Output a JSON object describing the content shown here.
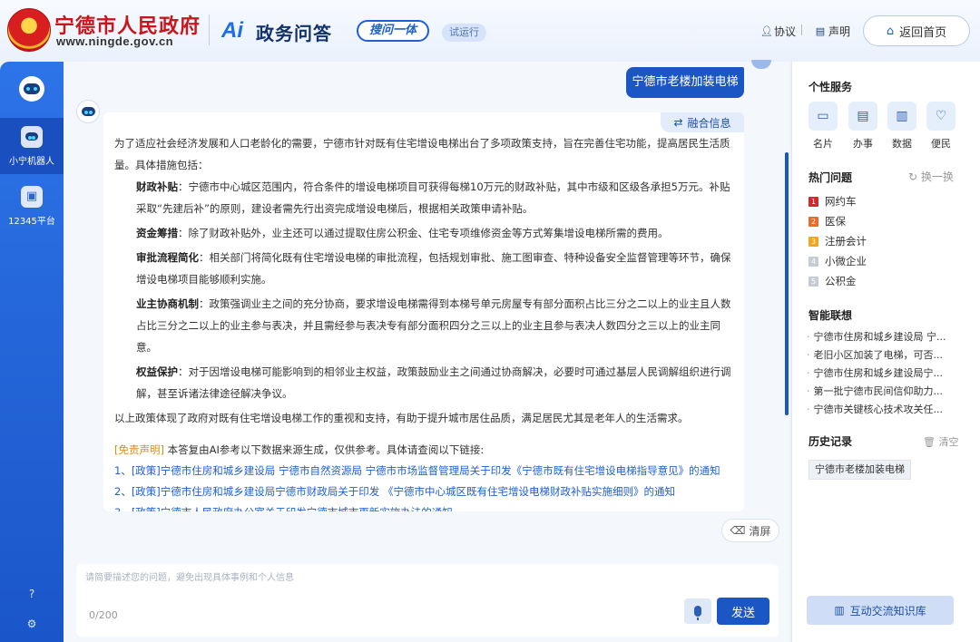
{
  "header": {
    "site_name": "宁德市人民政府",
    "site_url": "www.ningde.gov.cn",
    "product_logo": "Ai",
    "product_name": "政务问答",
    "search_badge": "搜问一体",
    "trial_badge": "试运行",
    "agreement": "协议",
    "statement": "声明",
    "home_button": "返回首页"
  },
  "sidebar": {
    "items": [
      {
        "label": "小宁机器人",
        "icon": "robot-icon"
      },
      {
        "label": "12345平台",
        "icon": "hotline-icon"
      }
    ],
    "bottom_icons": [
      "help-icon",
      "settings-icon"
    ]
  },
  "chat": {
    "user_message": "宁德市老楼加装电梯",
    "fuse_info": "融合信息",
    "intro": "为了适应社会经济发展和人口老龄化的需要，宁德市针对既有住宅增设电梯出台了多项政策支持，旨在完善住宅功能，提高居民生活质量。具体措施包括：",
    "items": [
      {
        "title": "财政补贴",
        "text": "：宁德市中心城区范围内，符合条件的增设电梯项目可获得每梯10万元的财政补贴，其中市级和区级各承担5万元。补贴采取“先建后补”的原则，建设者需先行出资完成增设电梯后，根据相关政策申请补贴。"
      },
      {
        "title": "资金筹措",
        "text": "：除了财政补贴外，业主还可以通过提取住房公积金、住宅专项维修资金等方式筹集增设电梯所需的费用。"
      },
      {
        "title": "审批流程简化",
        "text": "：相关部门将简化既有住宅增设电梯的审批流程，包括规划审批、施工图审查、特种设备安全监督管理等环节，确保增设电梯项目能够顺利实施。"
      },
      {
        "title": "业主协商机制",
        "text": "：政策强调业主之间的充分协商，要求增设电梯需得到本梯号单元房屋专有部分面积占比三分之二以上的业主且人数占比三分之二以上的业主参与表决，并且需经参与表决专有部分面积四分之三以上的业主且参与表决人数四分之三以上的业主同意。"
      },
      {
        "title": "权益保护",
        "text": "：对于因增设电梯可能影响到的相邻业主权益，政策鼓励业主之间通过协商解决，必要时可通过基层人民调解组织进行调解，甚至诉诸法律途径解决争议。"
      }
    ],
    "conclusion": "以上政策体现了政府对既有住宅增设电梯工作的重视和支持，有助于提升城市居住品质，满足居民尤其是老年人的生活需求。",
    "disclaimer_tag": "[免责声明]",
    "disclaimer_text": " 本答复由AI参考以下数据来源生成，仅供参考。具体请查阅以下链接:",
    "references": [
      "1、[政策]宁德市住房和城乡建设局 宁德市自然资源局 宁德市市场监督管理局关于印发《宁德市既有住宅增设电梯指导意见》的通知",
      "2、[政策]宁德市住房和城乡建设局宁德市财政局关于印发 《宁德市中心城区既有住宅增设电梯财政补贴实施细则》的通知",
      "3、[政策]宁德市人民政府办公室关于印发宁德市城市更新实施办法的通知"
    ],
    "clear_screen": "清屏"
  },
  "input": {
    "placeholder": "请简要描述您的问题，避免出现具体事例和个人信息",
    "value": "",
    "counter": "0/200",
    "send": "发送"
  },
  "right_panel": {
    "personal_title": "个性服务",
    "services": [
      {
        "label": "名片",
        "icon": "card-icon"
      },
      {
        "label": "办事",
        "icon": "service-icon"
      },
      {
        "label": "数据",
        "icon": "chart-icon"
      },
      {
        "label": "便民",
        "icon": "heart-icon"
      }
    ],
    "hot_title": "热门问题",
    "refresh": "换一换",
    "hot": [
      {
        "rank": "1",
        "label": "网约车",
        "color": "#d9252b"
      },
      {
        "rank": "2",
        "label": "医保",
        "color": "#ea6a2a"
      },
      {
        "rank": "3",
        "label": "注册会计",
        "color": "#f0a61f"
      },
      {
        "rank": "4",
        "label": "小微企业",
        "color": "#c7ccd4"
      },
      {
        "rank": "5",
        "label": "公积金",
        "color": "#c7ccd4"
      }
    ],
    "assoc_title": "智能联想",
    "assoc": [
      "宁德市住房和城乡建设局 宁...",
      "老旧小区加装了电梯，可否...",
      "宁德市住房和城乡建设局宁...",
      "第一批宁德市民间信仰助力...",
      "宁德市关键核心技术攻关任..."
    ],
    "history_title": "历史记录",
    "clear_history": "清空",
    "history": [
      "宁德市老楼加装电梯"
    ],
    "kb_button": "互动交流知识库"
  }
}
